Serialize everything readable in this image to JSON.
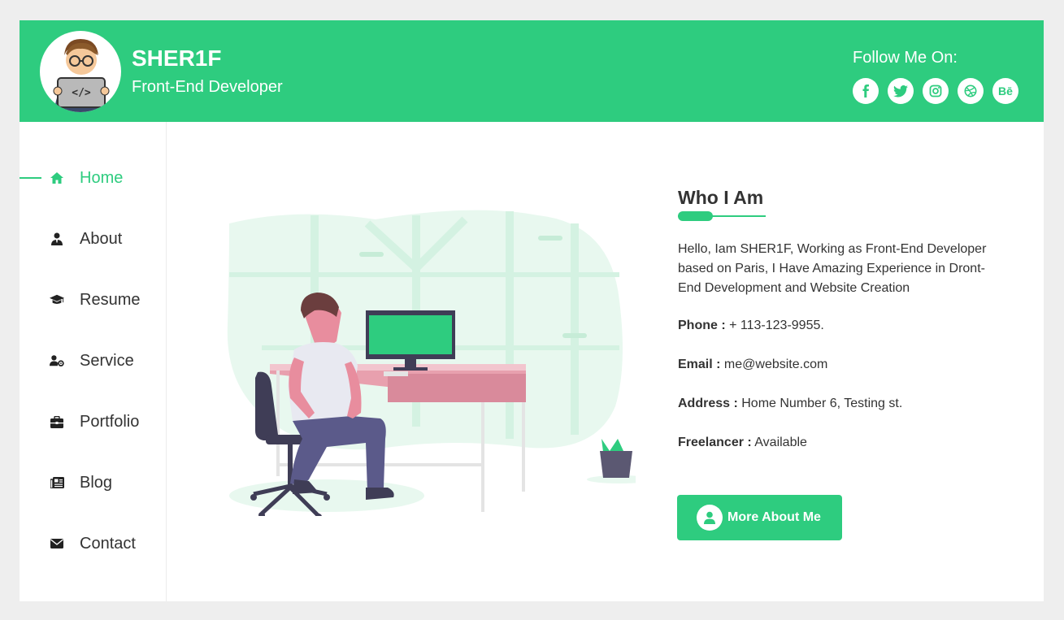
{
  "header": {
    "name": "SHER1F",
    "role": "Front-End Developer",
    "follow_label": "Follow Me On:",
    "socials": [
      {
        "icon": "facebook-icon",
        "glyph": "f"
      },
      {
        "icon": "twitter-icon",
        "glyph": ""
      },
      {
        "icon": "instagram-icon",
        "glyph": ""
      },
      {
        "icon": "dribbble-icon",
        "glyph": ""
      },
      {
        "icon": "behance-icon",
        "glyph": "Bē"
      }
    ]
  },
  "nav": {
    "items": [
      {
        "label": "Home",
        "icon": "home-icon",
        "active": true
      },
      {
        "label": "About",
        "icon": "user-tie-icon"
      },
      {
        "label": "Resume",
        "icon": "graduation-cap-icon"
      },
      {
        "label": "Service",
        "icon": "user-cog-icon"
      },
      {
        "label": "Portfolio",
        "icon": "briefcase-icon"
      },
      {
        "label": "Blog",
        "icon": "newspaper-icon"
      },
      {
        "label": "Contact",
        "icon": "envelope-icon"
      }
    ]
  },
  "about": {
    "title": "Who I Am",
    "bio": "Hello, Iam SHER1F, Working as Front-End Developer based on Paris, I Have Amazing Experience in Dront-End Development and Website Creation",
    "phone_label": "Phone :",
    "phone": "+ 113-123-9955.",
    "email_label": "Email :",
    "email": "me@website.com",
    "address_label": "Address :",
    "address": "Home Number 6, Testing st.",
    "freelancer_label": "Freelancer :",
    "freelancer": "Available",
    "button_label": "More About Me"
  },
  "colors": {
    "accent": "#2ecc7f",
    "page_bg": "#eeeeee",
    "text": "#333333"
  }
}
